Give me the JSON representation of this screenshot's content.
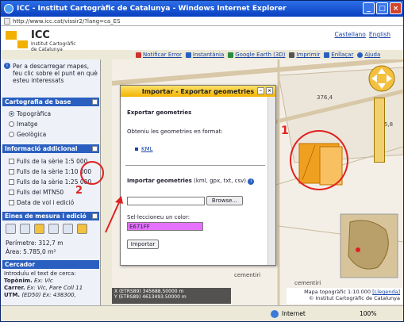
{
  "window": {
    "title": "ICC - Institut Cartogràfic de Catalunya - Windows Internet Explorer",
    "url": "http://www.icc.cat/vissir2/?lang=ca_ES"
  },
  "header": {
    "brand": "ICC",
    "brand_sub1": "Institut Cartogràfic",
    "brand_sub2": "de Catalunya",
    "langs": [
      "Castellano",
      "English"
    ]
  },
  "toolbar": {
    "items": [
      {
        "label": "Notificar Error",
        "color": "#d03030"
      },
      {
        "label": "Instantània",
        "color": "#2a5fc0"
      },
      {
        "label": "Google Earth (3D)",
        "color": "#2a8a40"
      },
      {
        "label": "Imprimir",
        "color": "#555555"
      },
      {
        "label": "Enllaçar",
        "color": "#2a5fc0"
      },
      {
        "label": "Ajuda",
        "color": "#2a5fc0"
      }
    ]
  },
  "sidebar": {
    "info": "Per a descarregar mapes, feu clic sobre el punt en què esteu interessats",
    "base": {
      "title": "Cartografia de base",
      "options": [
        "Topogràfica",
        "Imatge",
        "Geològica"
      ],
      "selected": 0
    },
    "extra": {
      "title": "Informació addicional",
      "options": [
        "Fulls de la sèrie 1:5 000",
        "Fulls de la sèrie 1:10 000",
        "Fulls de la sèrie 1:25 000",
        "Fulls del MTN50",
        "Data de vol i edició"
      ]
    },
    "tools": {
      "title": "Eines de mesura i edició",
      "perimeter": "Perímetre: 312,7 m",
      "area": "Àrea: 5.785,0 m²"
    },
    "search": {
      "title": "Cercador",
      "intro": "Introduïu el text de cerca:",
      "lines": [
        [
          "Topònim.",
          "Ex: Vic"
        ],
        [
          "Carrer.",
          "Ex: Vic, Pare Coll 11"
        ],
        [
          "UTM.",
          "(ED50) Ex: 438300,"
        ]
      ]
    }
  },
  "annotations": {
    "one": "1",
    "two": "2"
  },
  "map": {
    "labels": [
      "376,4",
      "375,8",
      "cementiri",
      "cementiri"
    ]
  },
  "dialog": {
    "title": "Importar - Exportar geometries",
    "export_title": "Exportar geometries",
    "export_desc": "Obteniu les geometries en format:",
    "kml": "KML",
    "import_title": "Importar geometries",
    "import_formats": "(kml, gpx, txt, csv)",
    "browse": "Browse...",
    "color_label": "Sel·leccioneu un color:",
    "color_value": "E671FF",
    "import_button": "Importar"
  },
  "coords": {
    "x": "X (ETRS89) 345688.50000 m",
    "y": "Y (ETRS89) 4613493.50000 m"
  },
  "mapinfo": {
    "scale": "Mapa topogràfic 1:10.000",
    "legend": "[Llegenda]",
    "copyright": "© Institut Cartogràfic de Catalunya"
  },
  "status": {
    "zone": "Internet",
    "zoom": "100%"
  }
}
